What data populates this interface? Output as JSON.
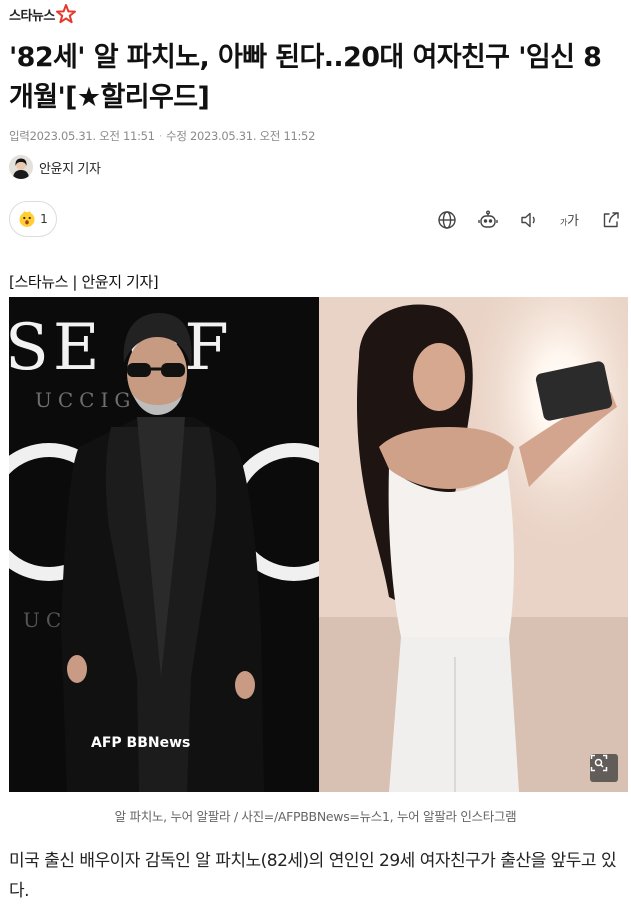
{
  "press": {
    "name": "스타뉴스",
    "star_color": "#e8382c"
  },
  "article": {
    "headline": "'82세' 알 파치노, 아빠 된다..20대 여자친구 '임신 8개월'[★할리우드]",
    "input_label": "입력",
    "input_time": "2023.05.31. 오전 11:51",
    "update_label": "수정",
    "update_time": "2023.05.31. 오전 11:52",
    "author": "안윤지 기자",
    "source_line": "[스타뉴스 | 안윤지 기자]",
    "photo_left_credit": "AFP BBNews",
    "caption": "알 파치노, 누어 알팔라 / 사진=/AFPBBNews=뉴스1, 누어 알팔라 인스타그램",
    "body": "미국 출신 배우이자 감독인 알 파치노(82세)의 연인인 29세 여자친구가 출산을 앞두고 있다."
  },
  "reaction": {
    "icon": "surprised-face-icon",
    "count": "1"
  },
  "toolbar": {
    "items": [
      {
        "icon": "globe-icon"
      },
      {
        "icon": "robot-summary-icon"
      },
      {
        "icon": "speaker-icon"
      },
      {
        "icon": "font-size-icon",
        "label": "가가"
      },
      {
        "icon": "share-icon"
      }
    ]
  },
  "colors": {
    "text": "#111111",
    "meta": "#8a8a8a",
    "caption": "#666666",
    "border": "#dcdcdc"
  }
}
